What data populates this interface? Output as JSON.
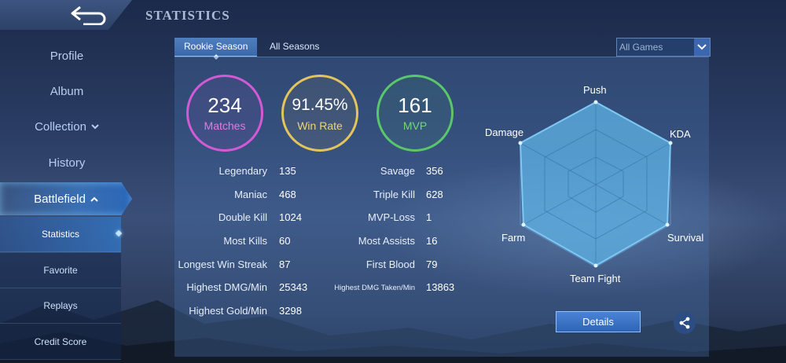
{
  "header": {
    "title": "STATISTICS",
    "back_icon": "back-arrow-icon"
  },
  "sidebar": {
    "items": [
      {
        "label": "Profile"
      },
      {
        "label": "Album"
      },
      {
        "label": "Collection",
        "icon": "chevron-down-icon"
      },
      {
        "label": "History"
      },
      {
        "label": "Battlefield",
        "icon": "chevron-up-icon",
        "active": true
      }
    ],
    "sub_items": [
      {
        "label": "Statistics",
        "active": true
      },
      {
        "label": "Favorite"
      },
      {
        "label": "Replays"
      },
      {
        "label": "Credit Score"
      }
    ]
  },
  "tabs": [
    {
      "label": "Rookie Season",
      "active": true
    },
    {
      "label": "All Seasons"
    }
  ],
  "filter": {
    "value": "All Games",
    "icon": "chevron-down-icon"
  },
  "summary": {
    "matches": {
      "value": "234",
      "label": "Matches",
      "color": "#d25ad4"
    },
    "win_rate": {
      "value": "91.45%",
      "label": "Win Rate",
      "color": "#e3c45d"
    },
    "mvp": {
      "value": "161",
      "label": "MVP",
      "color": "#59c76a"
    }
  },
  "stats_left": [
    {
      "label": "Legendary",
      "value": "135"
    },
    {
      "label": "Maniac",
      "value": "468"
    },
    {
      "label": "Double Kill",
      "value": "1024"
    },
    {
      "label": "Most Kills",
      "value": "60"
    },
    {
      "label": "Longest Win Streak",
      "value": "87"
    },
    {
      "label": "Highest DMG/Min",
      "value": "25343"
    },
    {
      "label": "Highest Gold/Min",
      "value": "3298"
    }
  ],
  "stats_right": [
    {
      "label": "Savage",
      "value": "356"
    },
    {
      "label": "Triple Kill",
      "value": "628"
    },
    {
      "label": "MVP-Loss",
      "value": "1"
    },
    {
      "label": "Most Assists",
      "value": "16"
    },
    {
      "label": "First Blood",
      "value": "79"
    },
    {
      "label": "Highest DMG Taken/Min",
      "value": "13863"
    }
  ],
  "radar": {
    "axes": [
      "Push",
      "KDA",
      "Survival",
      "Team Fight",
      "Farm",
      "Damage"
    ],
    "fill_color": "#5fb3e6"
  },
  "actions": {
    "details_label": "Details",
    "share_icon": "share-icon"
  }
}
